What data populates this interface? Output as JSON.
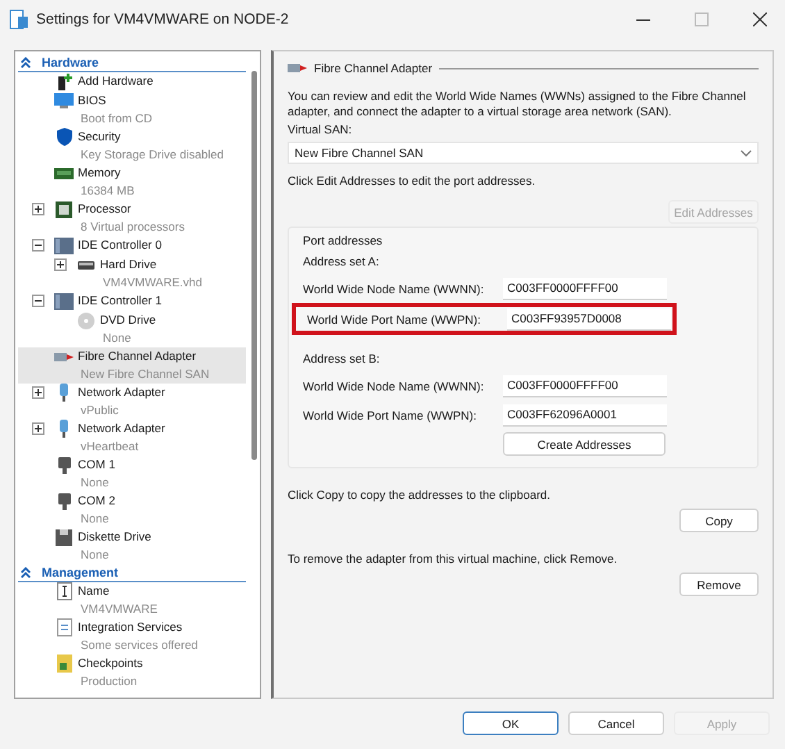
{
  "window": {
    "title": "Settings for VM4VMWARE on NODE-2"
  },
  "sidebar": {
    "sections": [
      {
        "title": "Hardware",
        "expanded": true,
        "items": [
          {
            "kind": "add",
            "name": "Add Hardware",
            "selected": false
          },
          {
            "kind": "monitor",
            "name": "BIOS",
            "detail": "Boot from CD",
            "selected": false
          },
          {
            "kind": "shield",
            "name": "Security",
            "detail": "Key Storage Drive disabled",
            "selected": false
          },
          {
            "kind": "memory",
            "name": "Memory",
            "detail": "16384 MB",
            "selected": false
          },
          {
            "kind": "chip",
            "name": "Processor",
            "detail": "8 Virtual processors",
            "expanded": false,
            "selected": false
          },
          {
            "kind": "controller",
            "name": "IDE Controller 0",
            "expanded": true,
            "selected": false,
            "children": [
              {
                "kind": "disk",
                "name": "Hard Drive",
                "detail": "VM4VMWARE.vhd",
                "expanded": false,
                "selected": false
              }
            ]
          },
          {
            "kind": "controller",
            "name": "IDE Controller 1",
            "expanded": true,
            "selected": false,
            "children": [
              {
                "kind": "disc",
                "name": "DVD Drive",
                "detail": "None",
                "selected": false
              }
            ]
          },
          {
            "kind": "plug",
            "name": "Fibre Channel Adapter",
            "detail": "New Fibre Channel SAN",
            "selected": true
          },
          {
            "kind": "network",
            "name": "Network Adapter",
            "detail": "vPublic",
            "expanded": false,
            "selected": false
          },
          {
            "kind": "network",
            "name": "Network Adapter",
            "detail": "vHeartbeat",
            "expanded": false,
            "selected": false
          },
          {
            "kind": "port",
            "name": "COM 1",
            "detail": "None",
            "selected": false
          },
          {
            "kind": "port",
            "name": "COM 2",
            "detail": "None",
            "selected": false
          },
          {
            "kind": "floppy",
            "name": "Diskette Drive",
            "detail": "None",
            "selected": false
          }
        ]
      },
      {
        "title": "Management",
        "expanded": true,
        "items": [
          {
            "kind": "name",
            "name": "Name",
            "detail": "VM4VMWARE",
            "selected": false
          },
          {
            "kind": "doc",
            "name": "Integration Services",
            "detail": "Some services offered",
            "selected": false
          },
          {
            "kind": "folder",
            "name": "Checkpoints",
            "detail": "Production",
            "selected": false
          }
        ]
      }
    ]
  },
  "panel": {
    "title": "Fibre Channel Adapter",
    "intro": "You can review and edit the World Wide Names (WWNs) assigned to the Fibre Channel adapter, and connect the adapter to a virtual storage area network (SAN).",
    "san_label": "Virtual SAN:",
    "san_value": "New Fibre Channel SAN",
    "edit_hint": "Click Edit Addresses to edit the port addresses.",
    "edit_button": {
      "label": "Edit Addresses",
      "disabled": true
    },
    "port_addresses": {
      "title": "Port addresses",
      "sets": [
        {
          "title": "Address set A:",
          "fields": [
            {
              "label": "World Wide Node Name (WWNN):",
              "value": "C003FF0000FFFF00",
              "highlighted": false
            },
            {
              "label": "World Wide Port Name (WWPN):",
              "value": "C003FF93957D0008",
              "highlighted": true
            }
          ]
        },
        {
          "title": "Address set B:",
          "fields": [
            {
              "label": "World Wide Node Name (WWNN):",
              "value": "C003FF0000FFFF00",
              "highlighted": false
            },
            {
              "label": "World Wide Port Name (WWPN):",
              "value": "C003FF62096A0001",
              "highlighted": false
            }
          ]
        }
      ],
      "create_button": "Create Addresses"
    },
    "copy_hint": "Click Copy to copy the addresses to the clipboard.",
    "copy_button": "Copy",
    "remove_hint": "To remove the adapter from this virtual machine, click Remove.",
    "remove_button": "Remove"
  },
  "buttons": [
    {
      "label": "OK",
      "default": true,
      "disabled": false
    },
    {
      "label": "Cancel",
      "default": false,
      "disabled": false
    },
    {
      "label": "Apply",
      "default": false,
      "disabled": true
    }
  ]
}
